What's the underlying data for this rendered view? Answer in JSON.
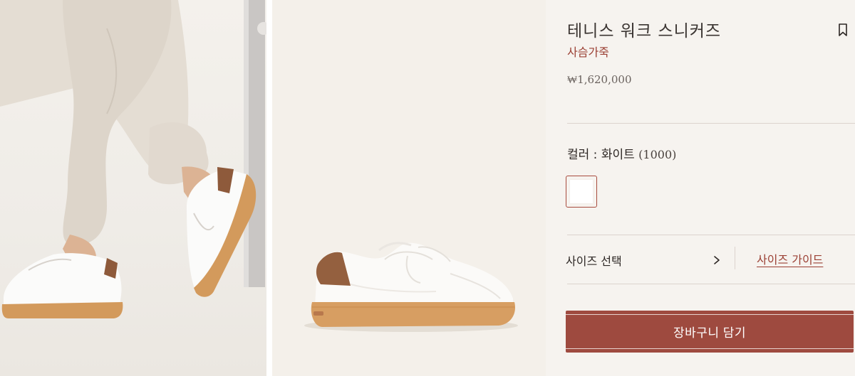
{
  "product": {
    "title": "테니스 워크 스니커즈",
    "material": "사슴가죽",
    "price": "₩1,620,000"
  },
  "color": {
    "label": "컬러 : 화이트",
    "code": "(1000)",
    "swatch_color": "#ffffff"
  },
  "size": {
    "select_label": "사이즈 선택",
    "guide_label": "사이즈 가이드"
  },
  "cart": {
    "button_label": "장바구니 담기"
  },
  "colors": {
    "accent": "#9e4a3f",
    "material_text": "#9b3f33",
    "background": "#f6f3ef"
  },
  "icons": {
    "bookmark": "bookmark-icon",
    "chevron": "chevron-right-icon"
  }
}
